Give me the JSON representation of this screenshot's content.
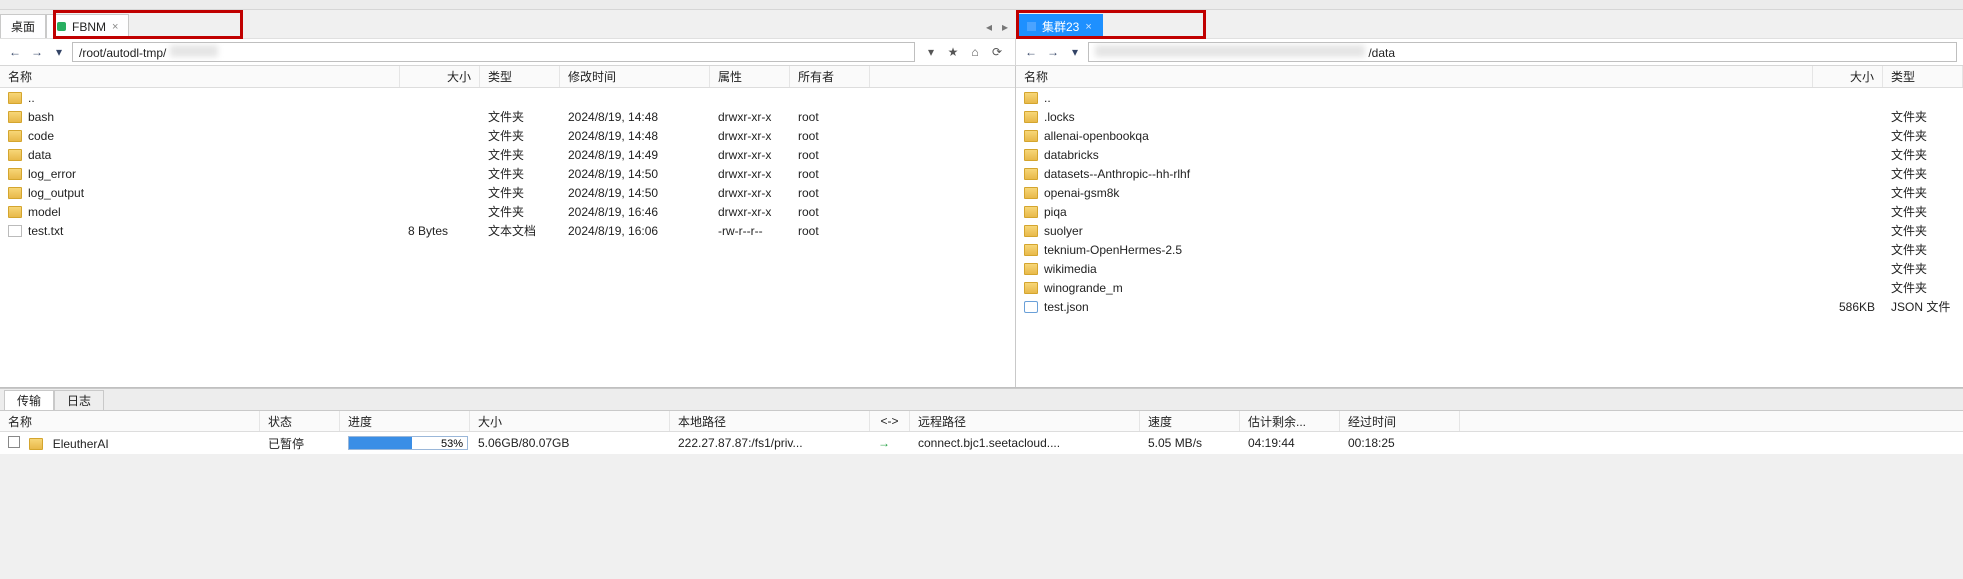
{
  "left_tabs": [
    {
      "label": "桌面"
    },
    {
      "label": "FBNM",
      "active": false,
      "dot": "green"
    }
  ],
  "right_tabs": [
    {
      "label": "集群23",
      "active": true,
      "dot": "blue"
    }
  ],
  "left_addr": "/root/autodl-tmp/",
  "right_addr": "/data",
  "left_cols": {
    "name": "名称",
    "size": "大小",
    "type": "类型",
    "mtime": "修改时间",
    "attr": "属性",
    "owner": "所有者"
  },
  "right_cols": {
    "name": "名称",
    "size": "大小",
    "type": "类型"
  },
  "left_files": [
    {
      "name": "..",
      "kind": "folder"
    },
    {
      "name": "bash",
      "kind": "folder",
      "type": "文件夹",
      "mtime": "2024/8/19, 14:48",
      "attr": "drwxr-xr-x",
      "owner": "root"
    },
    {
      "name": "code",
      "kind": "folder",
      "type": "文件夹",
      "mtime": "2024/8/19, 14:48",
      "attr": "drwxr-xr-x",
      "owner": "root"
    },
    {
      "name": "data",
      "kind": "folder",
      "type": "文件夹",
      "mtime": "2024/8/19, 14:49",
      "attr": "drwxr-xr-x",
      "owner": "root"
    },
    {
      "name": "log_error",
      "kind": "folder",
      "type": "文件夹",
      "mtime": "2024/8/19, 14:50",
      "attr": "drwxr-xr-x",
      "owner": "root"
    },
    {
      "name": "log_output",
      "kind": "folder",
      "type": "文件夹",
      "mtime": "2024/8/19, 14:50",
      "attr": "drwxr-xr-x",
      "owner": "root"
    },
    {
      "name": "model",
      "kind": "folder",
      "type": "文件夹",
      "mtime": "2024/8/19, 16:46",
      "attr": "drwxr-xr-x",
      "owner": "root"
    },
    {
      "name": "test.txt",
      "kind": "file",
      "size": "8 Bytes",
      "type": "文本文档",
      "mtime": "2024/8/19, 16:06",
      "attr": "-rw-r--r--",
      "owner": "root"
    }
  ],
  "right_files": [
    {
      "name": "..",
      "kind": "folder"
    },
    {
      "name": ".locks",
      "kind": "folder",
      "type": "文件夹"
    },
    {
      "name": "allenai-openbookqa",
      "kind": "folder",
      "type": "文件夹"
    },
    {
      "name": "databricks",
      "kind": "folder",
      "type": "文件夹"
    },
    {
      "name": "datasets--Anthropic--hh-rlhf",
      "kind": "folder",
      "type": "文件夹"
    },
    {
      "name": "openai-gsm8k",
      "kind": "folder",
      "type": "文件夹"
    },
    {
      "name": "piqa",
      "kind": "folder",
      "type": "文件夹"
    },
    {
      "name": "suolyer",
      "kind": "folder",
      "type": "文件夹"
    },
    {
      "name": "teknium-OpenHermes-2.5",
      "kind": "folder",
      "type": "文件夹"
    },
    {
      "name": "wikimedia",
      "kind": "folder",
      "type": "文件夹"
    },
    {
      "name": "winogrande_m",
      "kind": "folder",
      "type": "文件夹"
    },
    {
      "name": "test.json",
      "kind": "json",
      "size": "586KB",
      "type": "JSON 文件"
    }
  ],
  "bottom_tabs": {
    "transfer": "传输",
    "log": "日志"
  },
  "transfer_cols": {
    "name": "名称",
    "status": "状态",
    "prog": "进度",
    "size": "大小",
    "local": "本地路径",
    "dir": "<->",
    "remote": "远程路径",
    "speed": "速度",
    "eta": "估计剩余...",
    "elapsed": "经过时间"
  },
  "transfer_row": {
    "name": "EleutherAI",
    "status": "已暂停",
    "prog_pct": 53,
    "prog_text": "53%",
    "size": "5.06GB/80.07GB",
    "local": "222.27.87.87:/fs1/priv...",
    "remote": "connect.bjc1.seetacloud....",
    "speed": "5.05 MB/s",
    "eta": "04:19:44",
    "elapsed": "00:18:25"
  }
}
